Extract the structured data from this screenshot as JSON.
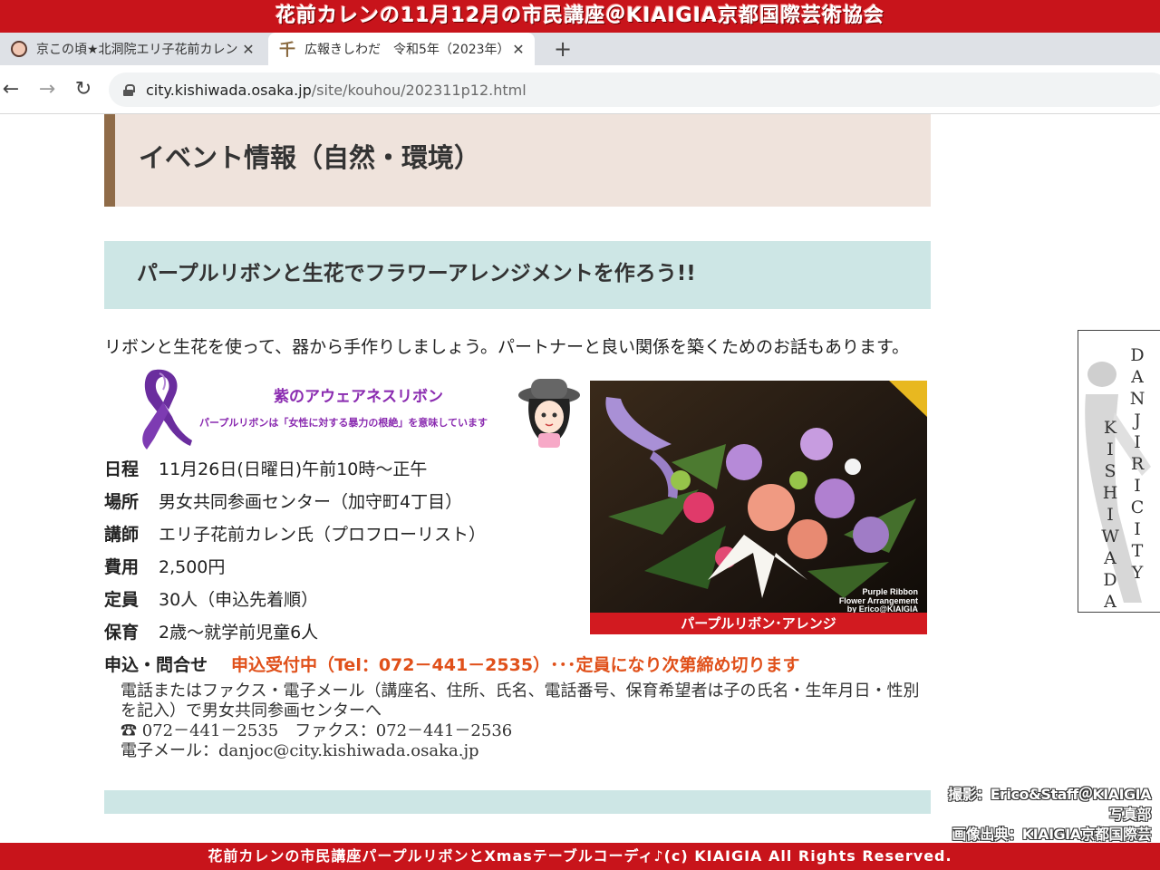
{
  "banner": {
    "top": "花前カレンの11月12月の市民講座＠KIAIGIA京都国際芸術協会",
    "bottom": "花前カレンの市民講座パープルリボンとXmasテーブルコーディ♪(c) KIAIGIA All Rights Reserved."
  },
  "browser": {
    "tabs": [
      {
        "title": "京この頃★北洞院エリ子花前カレン",
        "icon": "avatar-favicon-icon",
        "active": false
      },
      {
        "title": "広報きしわだ　令和5年（2023年）",
        "icon": "kishiwada-favicon-icon",
        "active": true
      }
    ],
    "tab_close": "✕",
    "new_tab": "+",
    "url_host": "city.kishiwada.osaka.jp",
    "url_path": "/site/kouhou/202311p12.html",
    "nav": {
      "back": "←",
      "forward": "→",
      "reload": "↻"
    }
  },
  "page": {
    "heading1": "イベント情報（自然・環境）",
    "heading2": "パープルリボンと生花でフラワーアレンジメントを作ろう!!",
    "intro": "リボンと生花を使って、器から手作りしましょう。パートナーと良い関係を築くためのお話もあります。",
    "ribbon": {
      "title": "紫のアウェアネスリボン",
      "subtitle": "パープルリボンは「女性に対する暴力の根絶」を意味しています"
    },
    "info": [
      {
        "label": "日程",
        "value": "11月26日(日曜日)午前10時～正午"
      },
      {
        "label": "場所",
        "value": "男女共同参画センター（加守町4丁目）"
      },
      {
        "label": "講師",
        "value": "エリ子花前カレン氏（プロフローリスト）"
      },
      {
        "label": "費用",
        "value": "2,500円"
      },
      {
        "label": "定員",
        "value": "30人（申込先着順）"
      },
      {
        "label": "保育",
        "value": "2歳～就学前児童6人"
      }
    ],
    "apply": {
      "label": "申込・問合せ",
      "status": "申込受付中（Tel：072－441－2535）･･･定員になり次第締め切ります"
    },
    "contact": {
      "line1": "電話またはファクス・電子メール（講座名、住所、氏名、電話番号、保育希望者は子の氏名・生年月日・性別を記入）で男女共同参画センターへ",
      "line2": "☎ 072－441－2535　ファクス：072－441－2536",
      "line3": "電子メール：danjoc@city.kishiwada.osaka.jp"
    },
    "photo": {
      "caption": "パープルリボン･アレンジ",
      "watermark1": "Purple Ribbon",
      "watermark2": "Flower Arrangement",
      "watermark3": "by Erico@KIAIGIA"
    }
  },
  "side_logo": {
    "col1": "DANJIRICITY",
    "col2": "KISHIWADA"
  },
  "credit": {
    "line1": "撮影：Erico&Staff＠KIAIGIA写真部",
    "line2": "画像出典：KIAIGIA京都国際芸術協会"
  },
  "colors": {
    "banner_red": "#c8141b",
    "heading1_bg": "#efe3dc",
    "heading1_border": "#8f6b48",
    "heading2_bg": "#cde6e5",
    "apply_orange": "#e0501a",
    "ribbon_purple": "#8a2bb0"
  }
}
